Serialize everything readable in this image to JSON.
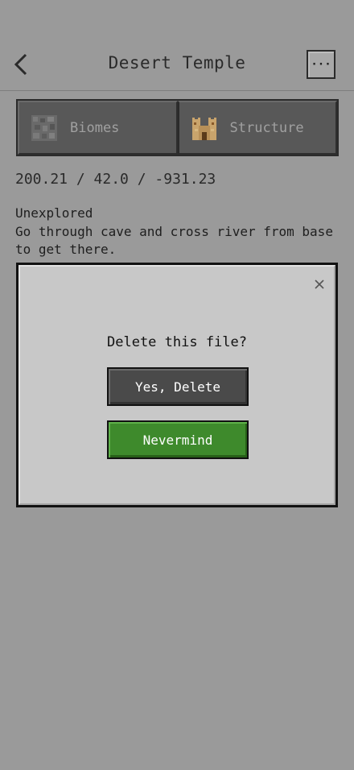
{
  "header": {
    "title": "Desert Temple",
    "more_label": "···"
  },
  "tabs": [
    {
      "label": "Biomes",
      "icon": "biome-block-icon"
    },
    {
      "label": "Structure",
      "icon": "temple-structure-icon"
    }
  ],
  "location": {
    "coordinates": "200.21 / 42.0 / -931.23",
    "status": "Unexplored",
    "description": "Go through cave and cross river from base to get there."
  },
  "dialog": {
    "title": "Delete this file?",
    "confirm_label": "Yes, Delete",
    "cancel_label": "Nevermind",
    "close_icon": "close-icon"
  },
  "colors": {
    "background": "#9a9a9a",
    "dialog_bg": "#c8c8c8",
    "delete_button": "#4a4a4a",
    "nevermind_button": "#3e8a2c"
  }
}
